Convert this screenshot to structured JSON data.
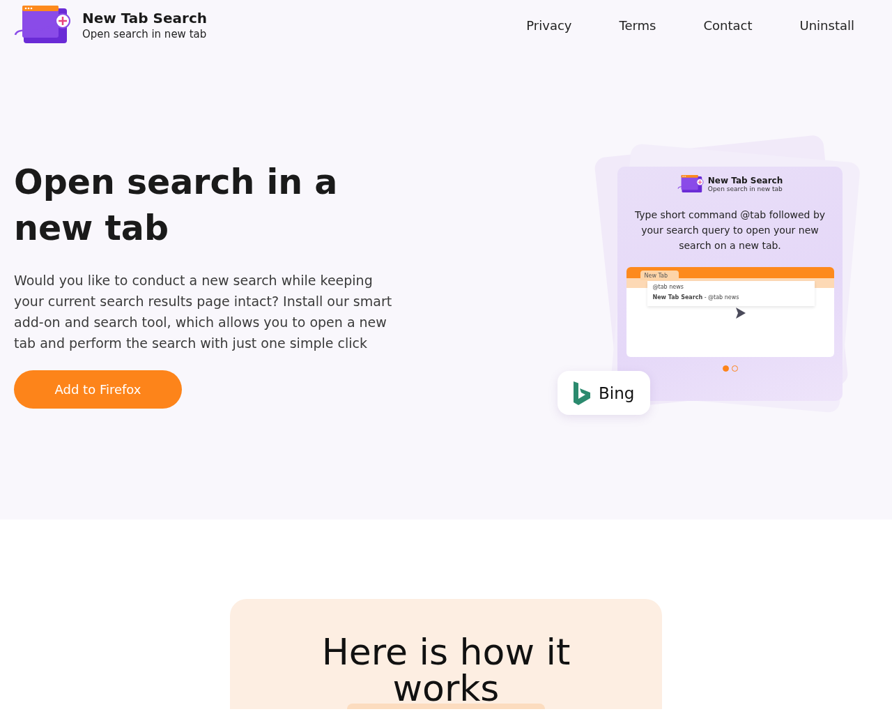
{
  "header": {
    "title": "New Tab Search",
    "subtitle": "Open search in new tab",
    "nav": [
      {
        "label": "Privacy"
      },
      {
        "label": "Terms"
      },
      {
        "label": "Contact"
      },
      {
        "label": "Uninstall"
      }
    ]
  },
  "hero": {
    "heading": "Open search in a new tab",
    "text": "Would you like to conduct a new search while keeping your current search results page intact? Install our smart add-on and search tool, which allows you to open a new tab and perform the search with just one simple click",
    "button": "Add to Firefox"
  },
  "preview": {
    "title": "New Tab Search",
    "subtitle": "Open search in new tab",
    "text": "Type short command @tab followed by your search query to open your new search on a new tab.",
    "browser": {
      "tab": "New Tab",
      "query": "@tab news",
      "suggestion_name": "New Tab Search",
      "suggestion_rest": " - @tab news"
    },
    "dots": [
      {
        "selected": true
      },
      {
        "selected": false
      }
    ],
    "badge": "Bing"
  },
  "how": {
    "heading": "Here is how it works"
  }
}
